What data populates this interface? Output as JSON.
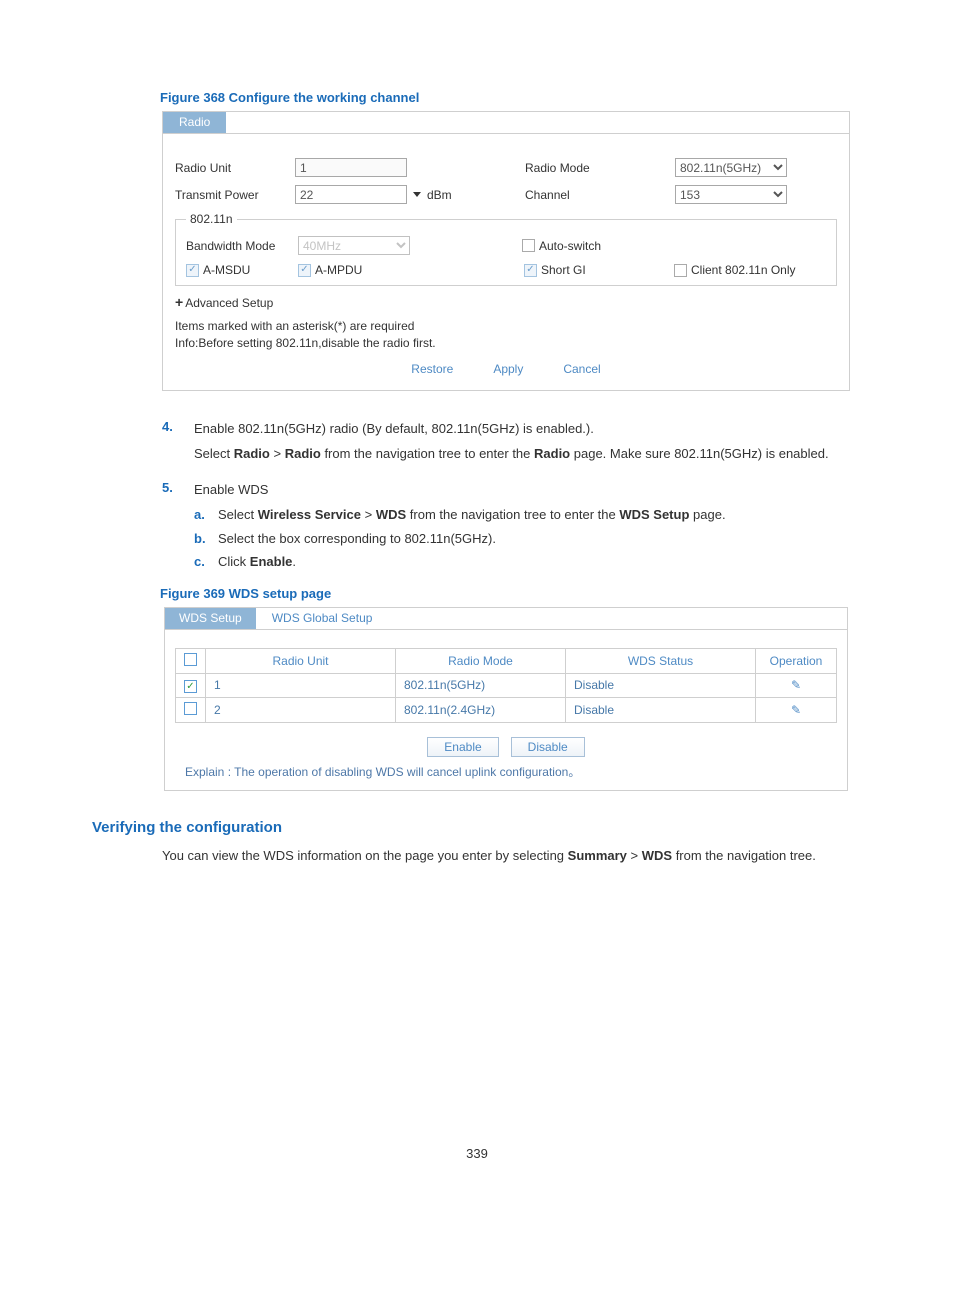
{
  "pageNumber": "339",
  "fig368": {
    "caption": "Figure 368 Configure the working channel",
    "tab": "Radio",
    "labels": {
      "radioUnit": "Radio Unit",
      "radioMode": "Radio Mode",
      "transmitPower": "Transmit Power",
      "channel": "Channel",
      "n_section": "802.11n",
      "bandwidthMode": "Bandwidth Mode",
      "autoSwitch": "Auto-switch",
      "amsdu": "A-MSDU",
      "ampdu": "A-MPDU",
      "shortGI": "Short GI",
      "clientN": "Client 802.11n Only",
      "advanced": "Advanced Setup",
      "dbm": "dBm"
    },
    "values": {
      "radioUnit": "1",
      "radioMode": "802.11n(5GHz)",
      "transmitPower": "22",
      "channel": "153",
      "bandwidthMode": "40MHz"
    },
    "notes1": "Items marked with an asterisk(*) are required",
    "notes2": "Info:Before setting 802.11n,disable the radio first.",
    "buttons": {
      "restore": "Restore",
      "apply": "Apply",
      "cancel": "Cancel"
    }
  },
  "step4": {
    "num": "4.",
    "title": "Enable 802.11n(5GHz) radio (By default, 802.11n(5GHz) is enabled.).",
    "text_pre": "Select ",
    "text_b1": "Radio",
    "text_gt": " > ",
    "text_b2": "Radio",
    "text_mid": " from the navigation tree to enter the ",
    "text_b3": "Radio",
    "text_post": " page. Make sure 802.11n(5GHz) is enabled."
  },
  "step5": {
    "num": "5.",
    "title": "Enable WDS",
    "a": {
      "let": "a.",
      "pre": "Select ",
      "b1": "Wireless Service",
      "gt": " > ",
      "b2": "WDS",
      "mid": " from the navigation tree to enter the ",
      "b3": "WDS Setup",
      "post": " page."
    },
    "b": {
      "let": "b.",
      "text": "Select the box corresponding to 802.11n(5GHz)."
    },
    "c": {
      "let": "c.",
      "pre": "Click ",
      "b": "Enable",
      "post": "."
    }
  },
  "fig369": {
    "caption": "Figure 369 WDS setup page",
    "tabs": {
      "active": "WDS Setup",
      "inactive": "WDS Global Setup"
    },
    "headers": {
      "unit": "Radio Unit",
      "mode": "Radio Mode",
      "status": "WDS Status",
      "op": "Operation"
    },
    "rows": [
      {
        "checked": true,
        "unit": "1",
        "mode": "802.11n(5GHz)",
        "status": "Disable"
      },
      {
        "checked": false,
        "unit": "2",
        "mode": "802.11n(2.4GHz)",
        "status": "Disable"
      }
    ],
    "buttons": {
      "enable": "Enable",
      "disable": "Disable"
    },
    "explain": "Explain : The operation of disabling WDS will cancel uplink configuration。"
  },
  "verify": {
    "heading": "Verifying the configuration",
    "pre": "You can view the WDS information on the page you enter by selecting ",
    "b1": "Summary",
    "gt": " > ",
    "b2": "WDS",
    "post": " from the navigation tree."
  }
}
